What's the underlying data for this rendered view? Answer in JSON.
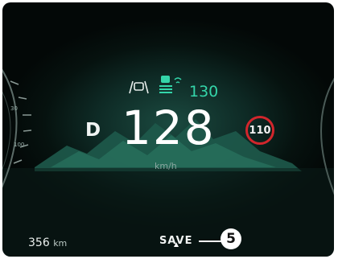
{
  "gear": "D",
  "speed": "128",
  "speed_unit": "km/h",
  "acc_set_speed": "130",
  "speed_limit": "110",
  "range": {
    "value": "356",
    "unit": "km"
  },
  "drive_mode": "SAVE",
  "callout_number": "5",
  "dial_ticks": [
    "30",
    "100"
  ],
  "icons": [
    "lane-departure-icon",
    "adaptive-cruise-icon",
    "mode-indicator-arrow-icon"
  ],
  "colors": {
    "accent": "#34d5a9",
    "speed_limit_ring": "#d2262c",
    "background": "#0e2a25"
  }
}
